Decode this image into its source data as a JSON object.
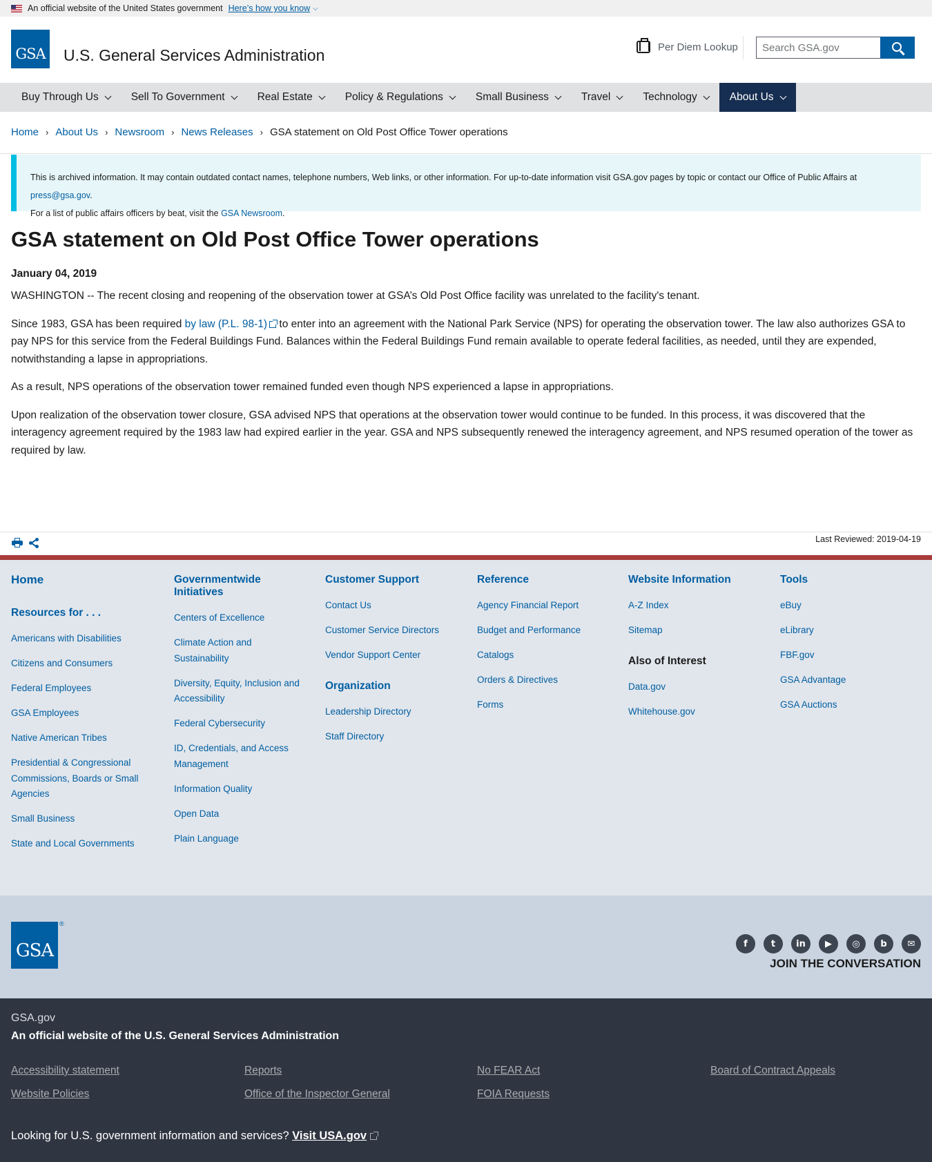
{
  "gov_banner": {
    "text": "An official website of the United States government",
    "know_link": "Here’s how you know"
  },
  "header": {
    "logo_text": "GSA",
    "site_title": "U.S. General Services Administration",
    "per_diem": "Per Diem Lookup",
    "search_placeholder": "Search GSA.gov"
  },
  "nav": [
    {
      "label": "Buy Through Us"
    },
    {
      "label": "Sell To Government"
    },
    {
      "label": "Real Estate"
    },
    {
      "label": "Policy & Regulations"
    },
    {
      "label": "Small Business"
    },
    {
      "label": "Travel"
    },
    {
      "label": "Technology"
    },
    {
      "label": "About Us",
      "active": true
    }
  ],
  "breadcrumb": {
    "items": [
      "Home",
      "About Us",
      "Newsroom",
      "News Releases"
    ],
    "current": "GSA statement on Old Post Office Tower operations"
  },
  "alert": {
    "line1_pre": "This is archived information. It may contain outdated contact names, telephone numbers, Web links, or other information. For up-to-date information visit GSA.gov pages by topic or contact our Office of Public Affairs at ",
    "email": "press@gsa.gov",
    "line1_post": ".",
    "line2_pre": "For a list of public affairs officers by beat, visit the ",
    "newsroom_link": "GSA Newsroom",
    "line2_post": "."
  },
  "article": {
    "title": "GSA statement on Old Post Office Tower operations",
    "date": "January 04, 2019",
    "p1": "WASHINGTON -- The recent closing and reopening of the observation tower at GSA’s Old Post Office facility was unrelated to the facility's tenant.",
    "p2_pre": "Since 1983, GSA has been required ",
    "p2_link": "by law (P.L. 98-1)",
    "p2_post": " to enter into an agreement with the National Park Service (NPS) for operating the observation tower. The law also authorizes GSA to pay NPS for this service from the Federal Buildings Fund. Balances within the Federal Buildings Fund remain available to operate federal facilities, as needed, until they are expended, notwithstanding a lapse in appropriations.",
    "p3": "As a result, NPS operations of the observation tower remained funded even though NPS experienced a lapse in appropriations.",
    "p4": "Upon realization of the observation tower closure, GSA advised NPS that operations at the observation tower would continue to be funded. In this process, it was discovered that the interagency agreement required by the 1983 law had expired earlier in the year. GSA and NPS subsequently renewed the interagency agreement, and NPS resumed operation of the tower as required by law."
  },
  "last_reviewed": "Last Reviewed: 2019-04-19",
  "footer": {
    "col1": {
      "home": "Home",
      "resources_head": "Resources for . . .",
      "items": [
        "Americans with Disabilities",
        "Citizens and Consumers",
        "Federal Employees",
        "GSA Employees",
        "Native American Tribes",
        "Presidential & Congressional Commissions, Boards or Small Agencies",
        "Small Business",
        "State and Local Governments"
      ]
    },
    "col2": {
      "head": "Governmentwide Initiatives",
      "items": [
        "Centers of Excellence",
        "Climate Action and Sustainability",
        "Diversity, Equity, Inclusion and Accessibility",
        "Federal Cybersecurity",
        "ID, Credentials, and Access Management",
        "Information Quality",
        "Open Data",
        "Plain Language"
      ]
    },
    "col3": {
      "head": "Customer Support",
      "items": [
        "Contact Us",
        "Customer Service Directors",
        "Vendor Support Center"
      ],
      "head2": "Organization",
      "items2": [
        "Leadership Directory",
        "Staff Directory"
      ]
    },
    "col4": {
      "head": "Reference",
      "items": [
        "Agency Financial Report",
        "Budget and Performance",
        "Catalogs",
        "Orders & Directives",
        "Forms"
      ]
    },
    "col5": {
      "head": "Website Information",
      "items": [
        "A-Z Index",
        "Sitemap"
      ],
      "head2": "Also of Interest",
      "items2": [
        "Data.gov",
        "Whitehouse.gov"
      ]
    },
    "col6": {
      "head": "Tools",
      "items": [
        "eBuy",
        "eLibrary",
        "FBF.gov",
        "GSA Advantage",
        "GSA Auctions"
      ]
    },
    "logo_text": "GSA",
    "logo_reg": "®",
    "socials": [
      {
        "icon": "facebook-icon",
        "glyph": "f"
      },
      {
        "icon": "twitter-icon",
        "glyph": "t"
      },
      {
        "icon": "linkedin-icon",
        "glyph": "in"
      },
      {
        "icon": "youtube-icon",
        "glyph": "▶"
      },
      {
        "icon": "instagram-icon",
        "glyph": "◎"
      },
      {
        "icon": "blog-icon",
        "glyph": "b"
      },
      {
        "icon": "email-icon",
        "glyph": "✉"
      }
    ],
    "join": "JOIN THE CONVERSATION",
    "site": "GSA.gov",
    "official": "An official website of the U.S. General Services Administration",
    "links": [
      "Accessibility statement",
      "Reports",
      "No FEAR Act",
      "Board of Contract Appeals",
      "Website Policies",
      "Office of the Inspector General",
      "FOIA Requests"
    ],
    "usa_text": "Looking for U.S. government information and services? ",
    "usa_link": "Visit USA.gov"
  },
  "colors": {
    "primary": "#005ea2",
    "nav_active": "#162e51",
    "alert_border": "#00bde3",
    "footer_red": "#a83a3a",
    "footer_dark": "#2f3541"
  }
}
